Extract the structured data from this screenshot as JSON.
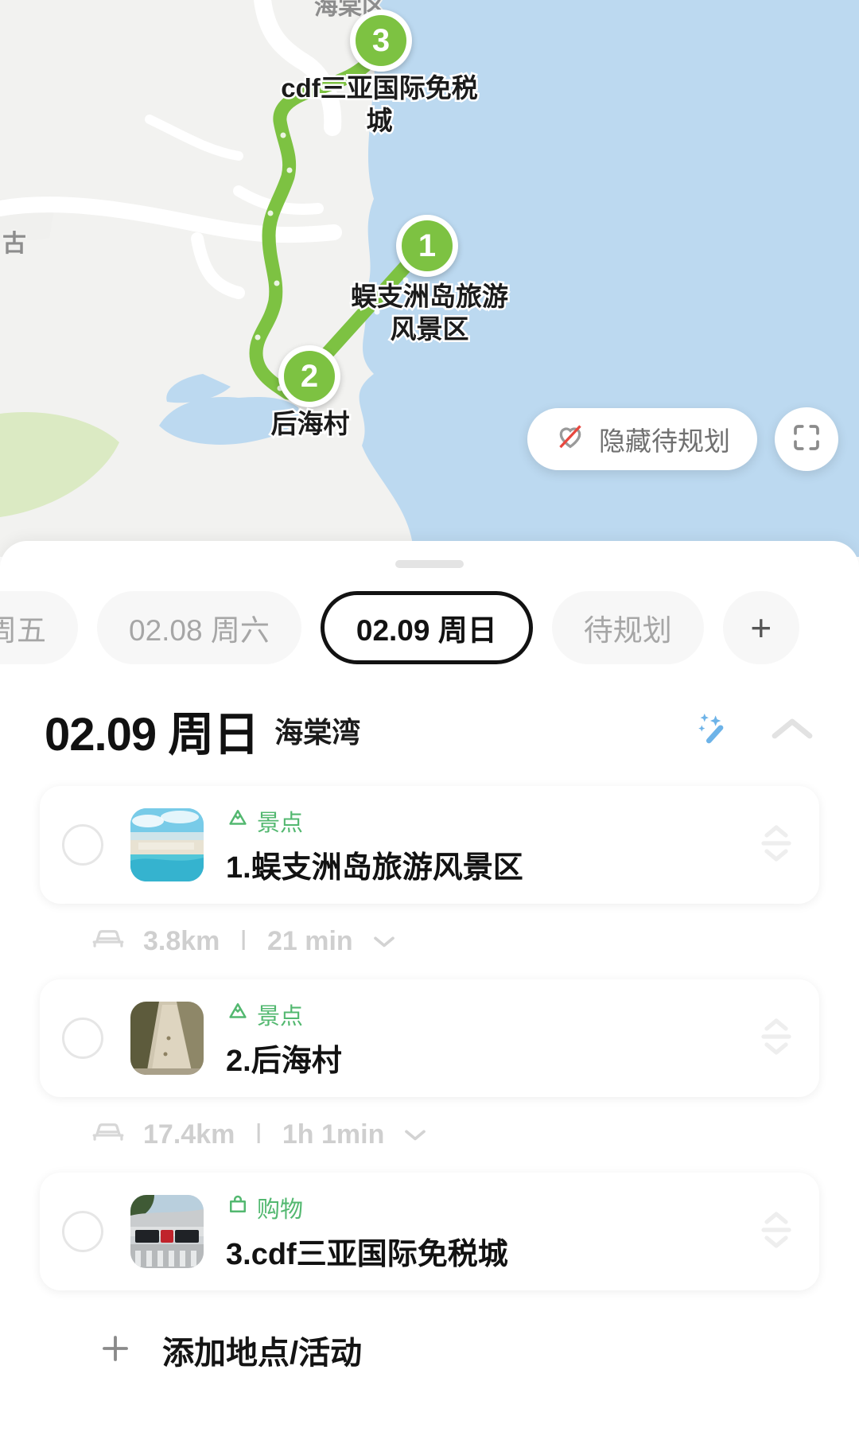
{
  "map": {
    "district_label": "海棠区",
    "west_label": "古",
    "markers": [
      {
        "num": "3",
        "label": "cdf三亚国际免税城"
      },
      {
        "num": "1",
        "label": "蜈支洲岛旅游\n风景区"
      },
      {
        "num": "2",
        "label": "后海村"
      }
    ],
    "hide_button": {
      "label": "隐藏待规划",
      "icon": "heart-slash-icon"
    },
    "fullscreen_button": {
      "icon": "fullscreen-icon"
    },
    "route_color": "#7dc242",
    "sea_color": "#bcd9f0",
    "land_color": "#f2f2f0",
    "park_color": "#dbeac3"
  },
  "sheet": {
    "tabs": [
      {
        "label": "周五",
        "active": false
      },
      {
        "label": "02.08 周六",
        "active": false
      },
      {
        "label": "02.09 周日",
        "active": true
      },
      {
        "label": "待规划",
        "active": false
      }
    ],
    "add_tab": {
      "label": "+"
    },
    "day_header": {
      "date": "02.09 周日",
      "place": "海棠湾",
      "ai_icon": "magic-wand-icon",
      "collapse_icon": "chevron-up-icon"
    },
    "items": [
      {
        "index": 0,
        "tag": "景点",
        "tag_icon": "mountain-icon",
        "title": "1.蜈支洲岛旅游风景区",
        "thumb": "beach-photo"
      },
      {
        "index": 1,
        "tag": "景点",
        "tag_icon": "mountain-icon",
        "title": "2.后海村",
        "thumb": "tent-photo"
      },
      {
        "index": 2,
        "tag": "购物",
        "tag_icon": "shopping-bag-icon",
        "title": "3.cdf三亚国际免税城",
        "thumb": "mall-photo"
      }
    ],
    "legs": [
      {
        "distance": "3.8km",
        "separator": "l",
        "duration": "21 min",
        "icon": "car-icon"
      },
      {
        "distance": "17.4km",
        "separator": "l",
        "duration": "1h 1min",
        "icon": "car-icon"
      }
    ],
    "add_row": {
      "label": "添加地点/活动",
      "icon": "plus-icon"
    }
  },
  "colors": {
    "accent_green": "#53b870",
    "marker_green": "#7dc242",
    "ai_blue": "#6db3e8",
    "muted": "#cfcfcf"
  }
}
